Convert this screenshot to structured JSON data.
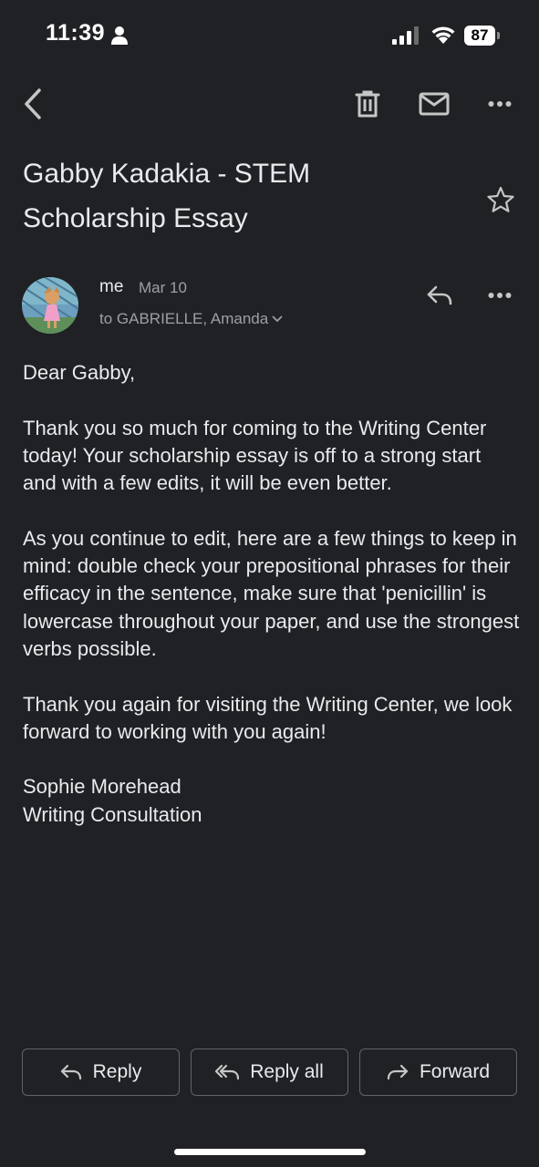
{
  "status_bar": {
    "time": "11:39",
    "battery": "87"
  },
  "toolbar": {
    "icons": [
      "back-icon",
      "trash-icon",
      "mail-icon",
      "more-icon"
    ]
  },
  "email": {
    "subject": "Gabby Kadakia - STEM Scholarship Essay",
    "sender": "me",
    "date": "Mar 10",
    "recipients": "to GABRIELLE, Amanda",
    "body": {
      "greeting": "Dear Gabby,",
      "paragraph1": "Thank you so much for coming to the Writing Center today! Your scholarship essay is off to a strong start and with a few edits, it will be even better.",
      "paragraph2": "As you continue to edit, here are a few things to keep in mind: double check your prepositional phrases for their efficacy in the sentence, make sure that 'penicillin' is lowercase throughout your paper, and use the strongest verbs possible.",
      "paragraph3": "Thank you again for visiting the Writing Center, we look forward to working with you again!",
      "signature_name": "Sophie Morehead",
      "signature_title": "Writing Consultation"
    }
  },
  "actions": {
    "reply": "Reply",
    "reply_all": "Reply all",
    "forward": "Forward"
  },
  "colors": {
    "background": "#202124",
    "text": "#e8eaed",
    "secondary_text": "#9aa0a6",
    "border": "#5f6368"
  }
}
